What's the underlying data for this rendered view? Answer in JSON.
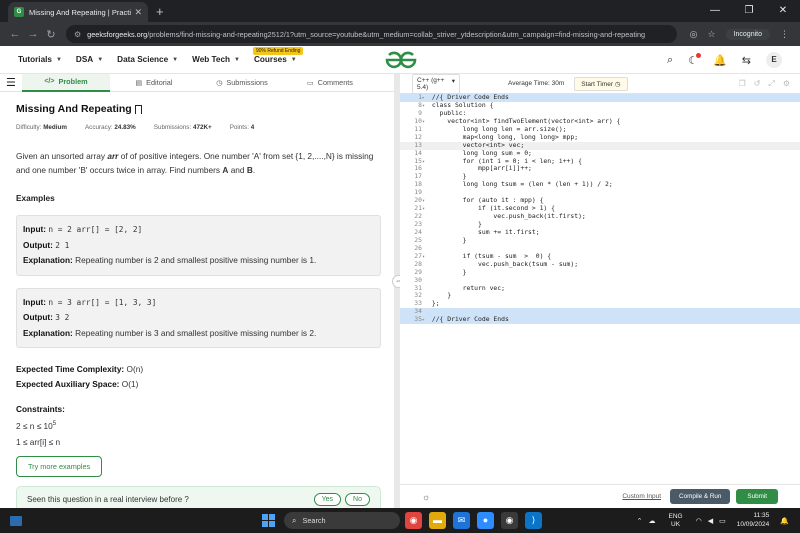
{
  "browser": {
    "tab_title": "Missing And Repeating | Practi",
    "url_host": "geeksforgeeks.org",
    "url_path": "/problems/find-missing-and-repeating2512/1?utm_source=youtube&utm_medium=collab_striver_ytdescription&utm_campaign=find-missing-and-repeating",
    "incognito_label": "Incognito"
  },
  "header": {
    "nav": [
      "Tutorials",
      "DSA",
      "Data Science",
      "Web Tech",
      "Courses"
    ],
    "refund_badge": "90% Refund Ending",
    "avatar_letter": "E"
  },
  "problem": {
    "tabs": [
      "Problem",
      "Editorial",
      "Submissions",
      "Comments"
    ],
    "title": "Missing And Repeating",
    "difficulty_label": "Difficulty:",
    "difficulty": "Medium",
    "accuracy_label": "Accuracy:",
    "accuracy": "24.83%",
    "submissions_label": "Submissions:",
    "submissions": "472K+",
    "points_label": "Points:",
    "points": "4",
    "desc_1": "Given an unsorted array ",
    "desc_arr": "arr",
    "desc_2": " of of positive integers. One number 'A' from set {1, 2,....,N} is missing and one number 'B' occurs twice in array. Find numbers ",
    "desc_A": "A",
    "desc_and": " and ",
    "desc_B": "B",
    "desc_end": ".",
    "examples_heading": "Examples",
    "examples": [
      {
        "input_label": "Input:",
        "input": "n = 2 arr[] = [2, 2]",
        "output_label": "Output:",
        "output": "2 1",
        "expl_label": "Explanation:",
        "explanation": "Repeating number is 2 and smallest positive missing number is 1."
      },
      {
        "input_label": "Input:",
        "input": "n = 3 arr[] = [1, 3, 3]",
        "output_label": "Output:",
        "output": "3 2",
        "expl_label": "Explanation:",
        "explanation": "Repeating number is 3 and smallest positive missing number is 2."
      }
    ],
    "time_label": "Expected Time Complexity:",
    "time_value": "O(n)",
    "space_label": "Expected Auxiliary Space:",
    "space_value": "O(1)",
    "constraints_heading": "Constraints:",
    "constraint_1_base": "2 ≤ n ≤ 10",
    "constraint_1_exp": "5",
    "constraint_2": "1 ≤ arr[i] ≤ n",
    "try_more": "Try more examples",
    "seen_question": "Seen this question in a real interview before ?",
    "yes": "Yes",
    "no": "No"
  },
  "editor": {
    "language": "C++ (g++ 5.4)",
    "avg_time": "Average Time: 30m",
    "start_timer": "Start Timer",
    "custom_input": "Custom Input",
    "compile_run": "Compile & Run",
    "submit": "Submit",
    "lines": [
      {
        "n": "1",
        "fold": "▸",
        "code": "//{ Driver Code Ends",
        "style": "comment",
        "hl": true
      },
      {
        "n": "8",
        "fold": "▾",
        "code": "class Solution {",
        "style": "plain"
      },
      {
        "n": "9",
        "fold": "",
        "code": "  public:",
        "style": "plain"
      },
      {
        "n": "10",
        "fold": "▾",
        "code": "    vector<int> findTwoElement(vector<int> arr) {",
        "style": "plain"
      },
      {
        "n": "11",
        "fold": "",
        "code": "        long long len = arr.size();",
        "style": "plain"
      },
      {
        "n": "12",
        "fold": "",
        "code": "        map<long long, long long> mpp;",
        "style": "plain"
      },
      {
        "n": "13",
        "fold": "",
        "code": "        vector<int> vec;",
        "style": "plain",
        "cur": true
      },
      {
        "n": "14",
        "fold": "",
        "code": "        long long sum = 0;",
        "style": "plain"
      },
      {
        "n": "15",
        "fold": "▾",
        "code": "        for (int i = 0; i < len; i++) {",
        "style": "plain"
      },
      {
        "n": "16",
        "fold": "",
        "code": "            mpp[arr[i]]++;",
        "style": "plain"
      },
      {
        "n": "17",
        "fold": "",
        "code": "        }",
        "style": "plain"
      },
      {
        "n": "18",
        "fold": "",
        "code": "        long long tsum = (len * (len + 1)) / 2;",
        "style": "plain"
      },
      {
        "n": "19",
        "fold": "",
        "code": "",
        "style": "plain"
      },
      {
        "n": "20",
        "fold": "▾",
        "code": "        for (auto it : mpp) {",
        "style": "plain"
      },
      {
        "n": "21",
        "fold": "▾",
        "code": "            if (it.second > 1) {",
        "style": "plain"
      },
      {
        "n": "22",
        "fold": "",
        "code": "                vec.push_back(it.first);",
        "style": "plain"
      },
      {
        "n": "23",
        "fold": "",
        "code": "            }",
        "style": "plain"
      },
      {
        "n": "24",
        "fold": "",
        "code": "            sum += it.first;",
        "style": "plain"
      },
      {
        "n": "25",
        "fold": "",
        "code": "        }",
        "style": "plain"
      },
      {
        "n": "26",
        "fold": "",
        "code": "",
        "style": "plain"
      },
      {
        "n": "27",
        "fold": "▾",
        "code": "        if (tsum - sum  >  0) {",
        "style": "plain"
      },
      {
        "n": "28",
        "fold": "",
        "code": "            vec.push_back(tsum - sum);",
        "style": "plain"
      },
      {
        "n": "29",
        "fold": "",
        "code": "        }",
        "style": "plain"
      },
      {
        "n": "30",
        "fold": "",
        "code": "",
        "style": "plain"
      },
      {
        "n": "31",
        "fold": "",
        "code": "        return vec;",
        "style": "plain"
      },
      {
        "n": "32",
        "fold": "",
        "code": "    }",
        "style": "plain"
      },
      {
        "n": "33",
        "fold": "",
        "code": "};",
        "style": "plain"
      },
      {
        "n": "34",
        "fold": "",
        "code": "",
        "style": "plain",
        "hl": true
      },
      {
        "n": "35",
        "fold": "▸",
        "code": "//{ Driver Code Ends",
        "style": "comment",
        "hl": true
      }
    ]
  },
  "taskbar": {
    "search_placeholder": "Search",
    "lang_1": "ENG",
    "lang_2": "UK",
    "time": "11:35",
    "date": "10/09/2024"
  },
  "colors": {
    "brand_green": "#2f8d46",
    "highlight_blue": "#cfe3f8"
  }
}
